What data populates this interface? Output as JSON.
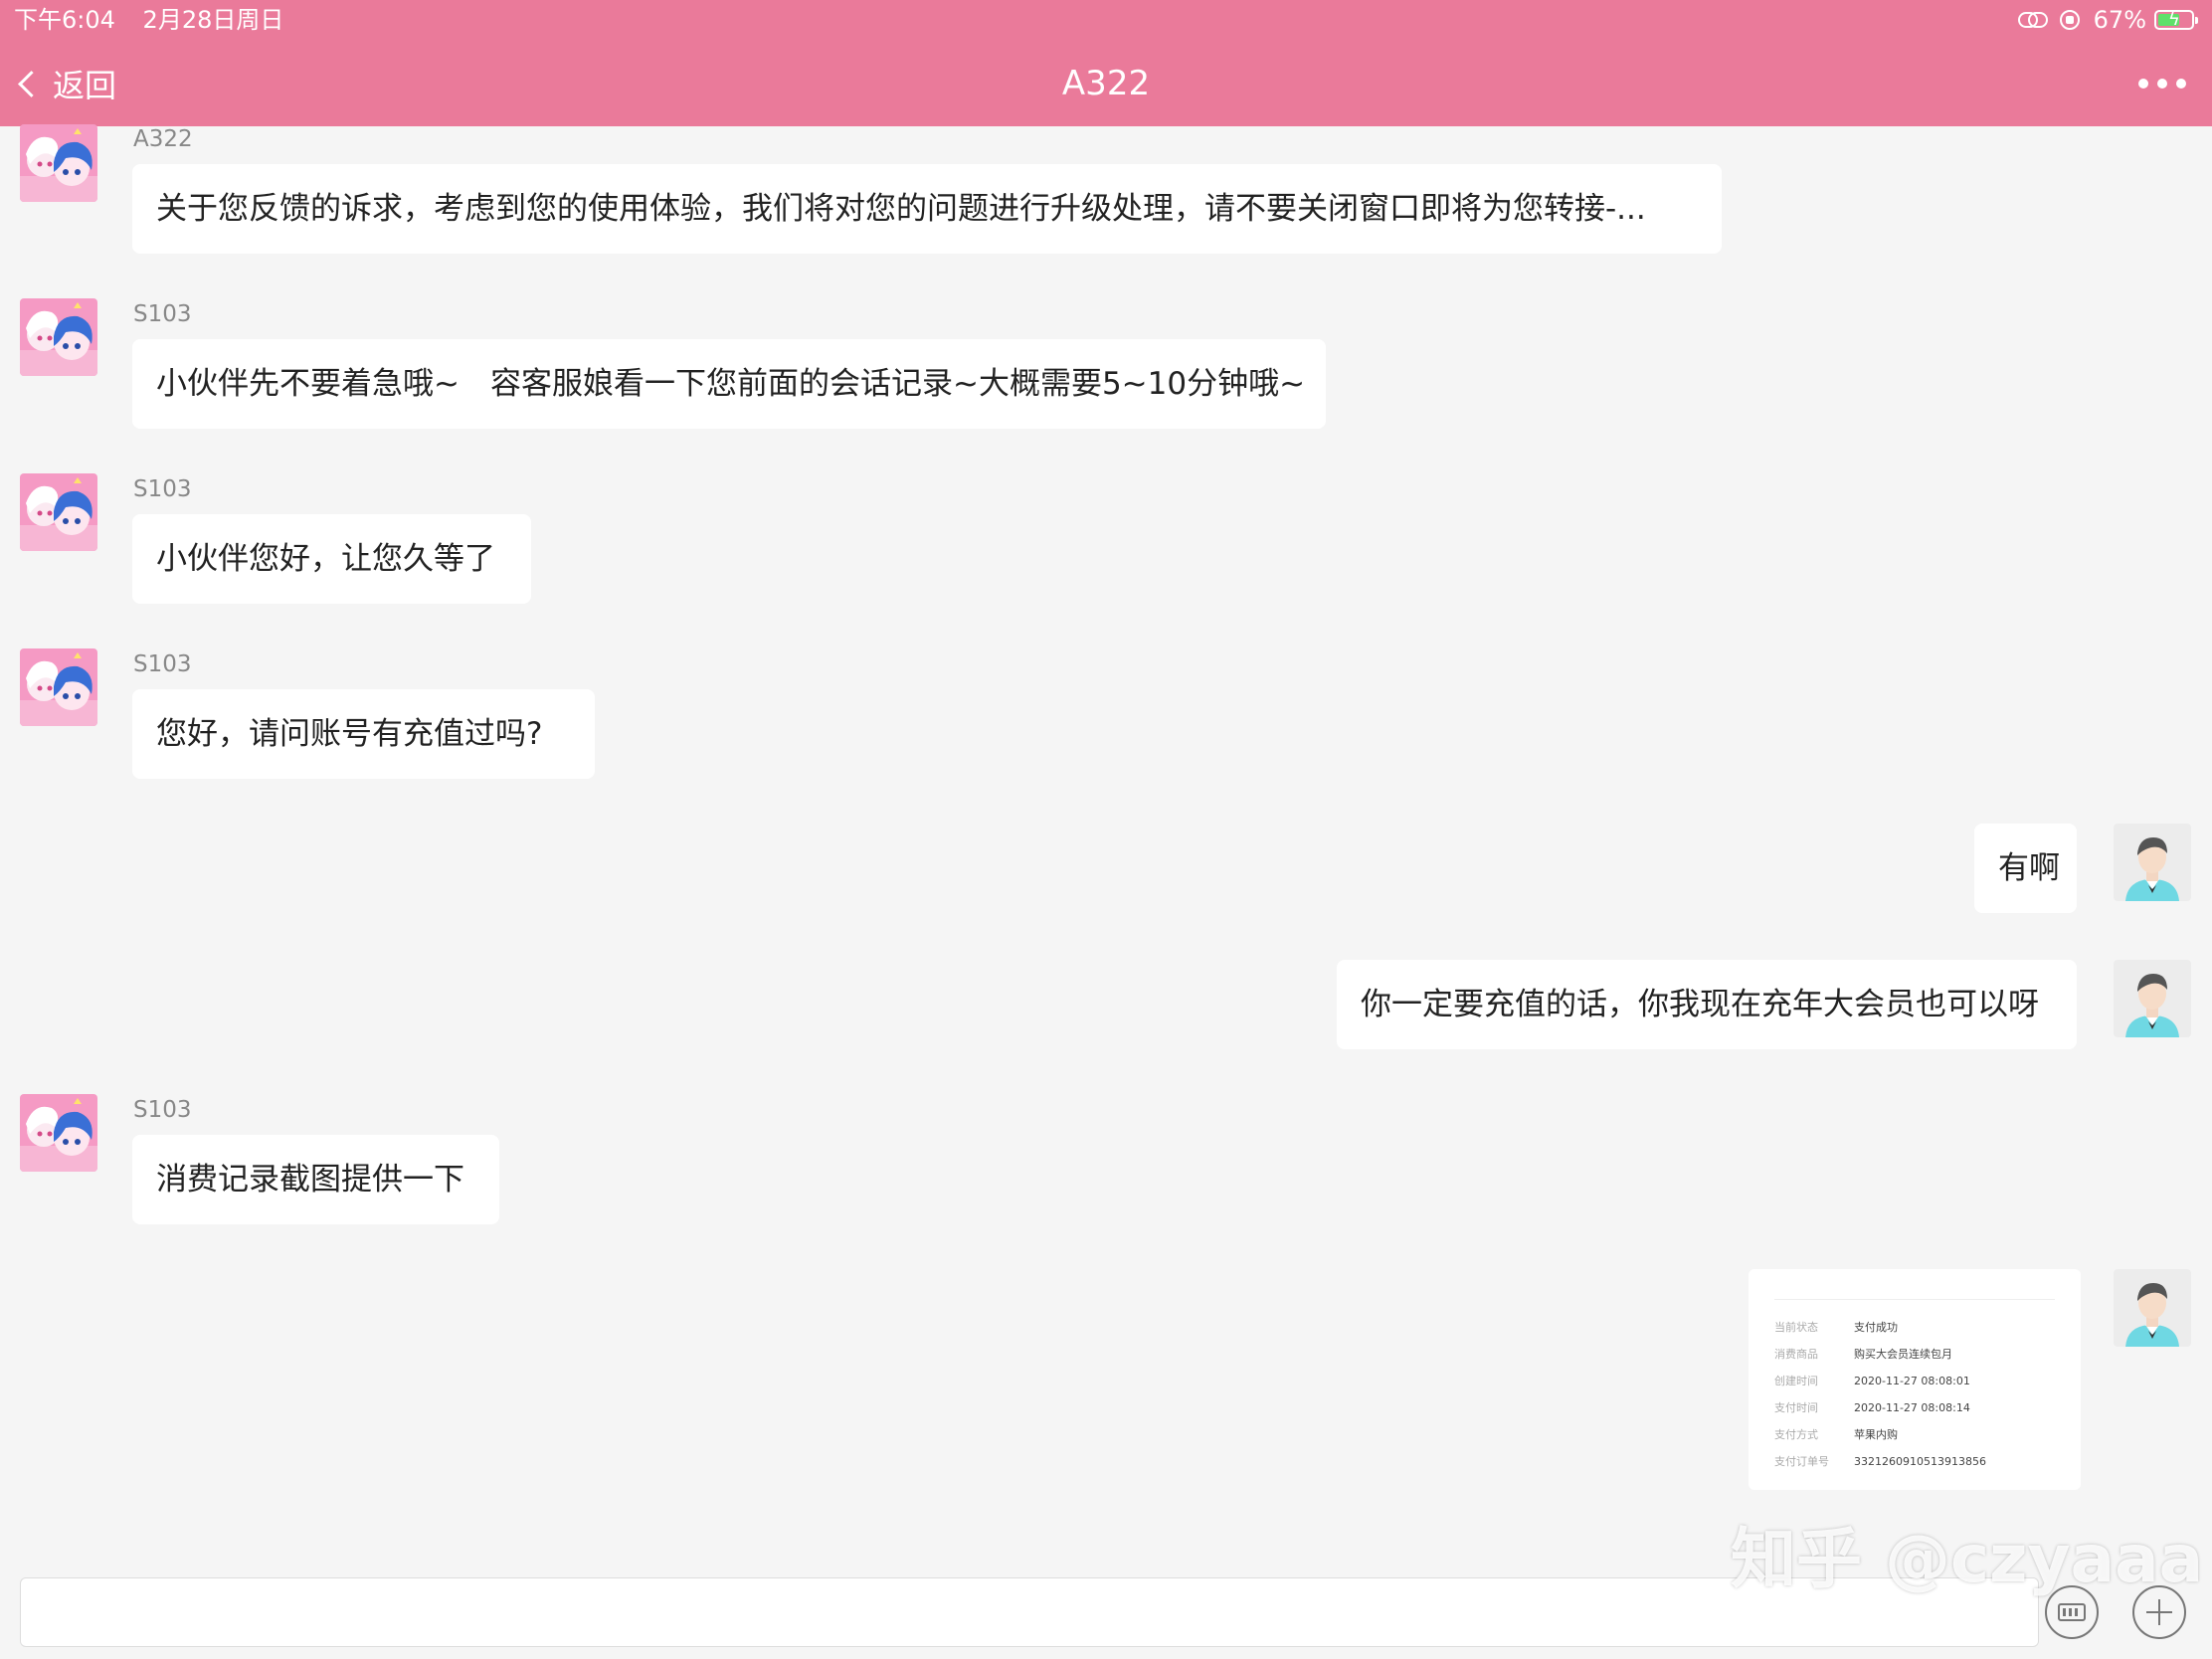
{
  "status_bar": {
    "time": "下午6:04",
    "date": "2月28日周日",
    "battery": "67%",
    "battery_level": 0.67
  },
  "nav": {
    "back_label": "返回",
    "title": "A322"
  },
  "messages": [
    {
      "sender": "A322",
      "text": "关于您反馈的诉求，考虑到您的使用体验，我们将对您的问题进行升级处理，请不要关闭窗口即将为您转接-..."
    },
    {
      "sender": "S103",
      "text": "小伙伴先不要着急哦~　容客服娘看一下您前面的会话记录~大概需要5~10分钟哦~"
    },
    {
      "sender": "S103",
      "text": "小伙伴您好，让您久等了"
    },
    {
      "sender": "S103",
      "text": "您好，请问账号有充值过吗?"
    },
    {
      "text": "有啊"
    },
    {
      "text": "你一定要充值的话，你我现在充年大会员也可以呀"
    },
    {
      "sender": "S103",
      "text": "消费记录截图提供一下"
    }
  ],
  "receipt": {
    "rows": [
      {
        "label": "当前状态",
        "value": "支付成功"
      },
      {
        "label": "消费商品",
        "value": "购买大会员连续包月"
      },
      {
        "label": "创建时间",
        "value": "2020-11-27 08:08:01"
      },
      {
        "label": "支付时间",
        "value": "2020-11-27 08:08:14"
      },
      {
        "label": "支付方式",
        "value": "苹果内购"
      },
      {
        "label": "支付订单号",
        "value": "3321260910513913856"
      }
    ]
  },
  "watermark": "知乎 @czyaaa",
  "input": {
    "value": ""
  }
}
